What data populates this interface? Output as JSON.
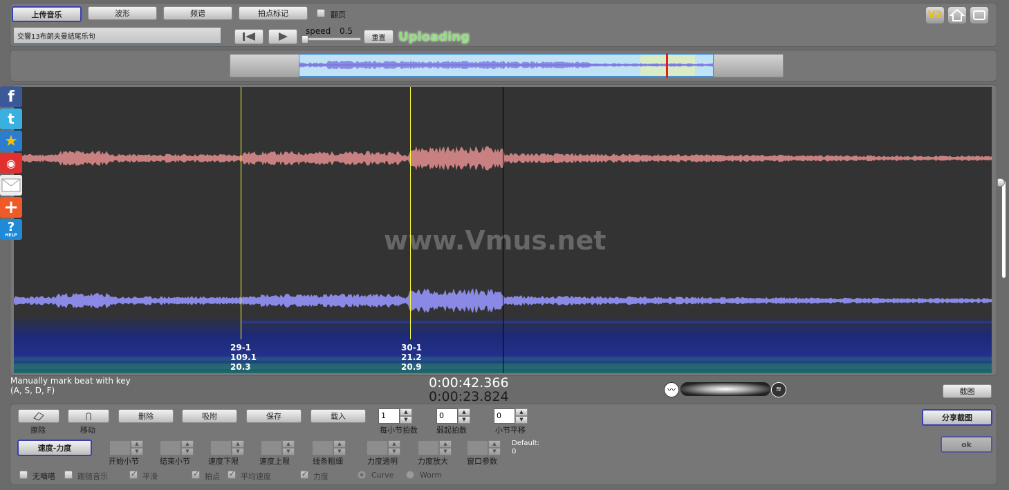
{
  "toolbar": {
    "upload_label": "上传音乐",
    "waveform_label": "波形",
    "spectrum_label": "频谱",
    "beat_label": "拍点标记",
    "pageflip_label": "翻页"
  },
  "file_name": "交響13布朗夫曼結尾乐句",
  "speed": {
    "label": "speed",
    "value": "0.5",
    "reset_label": "重置"
  },
  "status": "Uploading",
  "badge": "V2",
  "watermark": "www.Vmus.net",
  "markers": [
    {
      "line1": "29-1",
      "line2": "109.1",
      "line3": "20.3"
    },
    {
      "line1": "30-1",
      "line2": "21.2",
      "line3": "20.9"
    }
  ],
  "hint": {
    "line1": "Manually mark beat with key",
    "line2": "(A, S, D, F)"
  },
  "time": {
    "current": "0:00:42.366",
    "total": "0:00:23.824"
  },
  "screenshot_label": "截图",
  "tools": {
    "erase": "擦除",
    "move": "移动",
    "delete": "删除",
    "snap": "吸附",
    "save": "保存",
    "load": "载入"
  },
  "beats": {
    "per_bar": {
      "label": "每小节拍数",
      "value": "1"
    },
    "weak": {
      "label": "弱起拍数",
      "value": "0"
    },
    "shift": {
      "label": "小节平移",
      "value": "0"
    }
  },
  "share_label": "分享截图",
  "ok_label": "ok",
  "mode_label": "速度-力度",
  "params": {
    "start": "开始小节",
    "end": "结束小节",
    "low": "速度下限",
    "high": "速度上限",
    "line": "线条粗细",
    "opacity": "力度透明",
    "scale": "力度放大",
    "window": "窗口参数"
  },
  "default": {
    "label": "Default:",
    "value": "0"
  },
  "options": {
    "mute": "无嘀嗒",
    "follow": "跟随音乐",
    "smooth": "平滑",
    "beat": "拍点",
    "avg": "平均速度",
    "force": "力度",
    "curve": "Curve",
    "worm": "Worm"
  },
  "colors": {
    "accent": "#3a3fb0",
    "status": "#8fe07a",
    "top_wave": "#c98080",
    "bottom_wave": "#8a8ae6",
    "marker": "#ffff40"
  }
}
